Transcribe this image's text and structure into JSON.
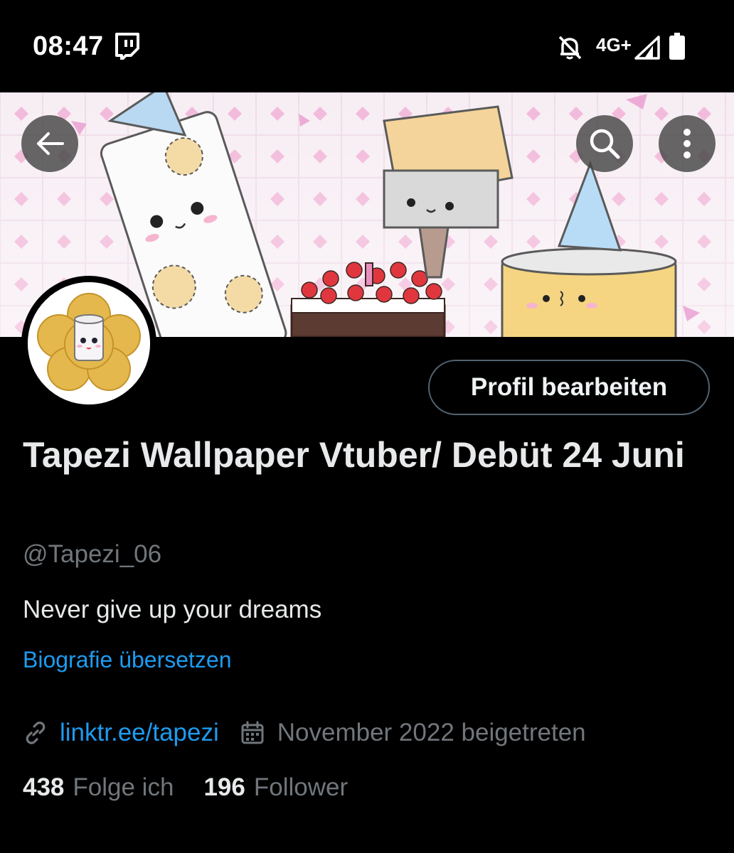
{
  "status_bar": {
    "time": "08:47",
    "network": "4G+",
    "icons": [
      "twitch-icon",
      "bell-off-icon",
      "signal-icon",
      "battery-icon"
    ]
  },
  "header": {
    "icons": [
      "back-arrow-icon",
      "search-icon",
      "more-vertical-icon"
    ]
  },
  "profile": {
    "edit_button": "Profil bearbeiten",
    "display_name": "Tapezi Wallpaper Vtuber/ Debüt 24 Juni",
    "handle": "@Tapezi_06",
    "bio": "Never give up your dreams",
    "translate_bio": "Biografie übersetzen",
    "link": "linktr.ee/tapezi",
    "joined": "November 2022 beigetreten",
    "following_count": "438",
    "following_label": "Folge ich",
    "followers_count": "196",
    "followers_label": "Follower"
  },
  "colors": {
    "background": "#000000",
    "accent_blue": "#1d9bf0",
    "secondary_text": "#71767b",
    "primary_text": "#e7e9ea"
  }
}
